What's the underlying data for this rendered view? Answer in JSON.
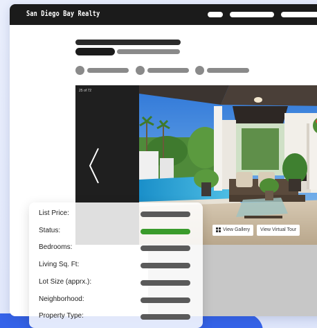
{
  "site": {
    "brand": "San Diego Bay Realty"
  },
  "gallery": {
    "counter": "25 of 72",
    "view_gallery": "View Gallery",
    "view_tour": "View Virtual Tour"
  },
  "details": {
    "rows": [
      {
        "label": "List Price:",
        "highlight": false
      },
      {
        "label": "Status:",
        "highlight": true
      },
      {
        "label": "Bedrooms:",
        "highlight": false
      },
      {
        "label": "Living Sq. Ft:",
        "highlight": false
      },
      {
        "label": "Lot Size (apprx.):",
        "highlight": false
      },
      {
        "label": "Neighborhood:",
        "highlight": false
      },
      {
        "label": "Property Type:",
        "highlight": false
      }
    ]
  },
  "colors": {
    "accent_blue": "#3563e9",
    "status_green": "#3a9b2b",
    "dark": "#1b1b1b",
    "placeholder": "#8a8a8a"
  }
}
